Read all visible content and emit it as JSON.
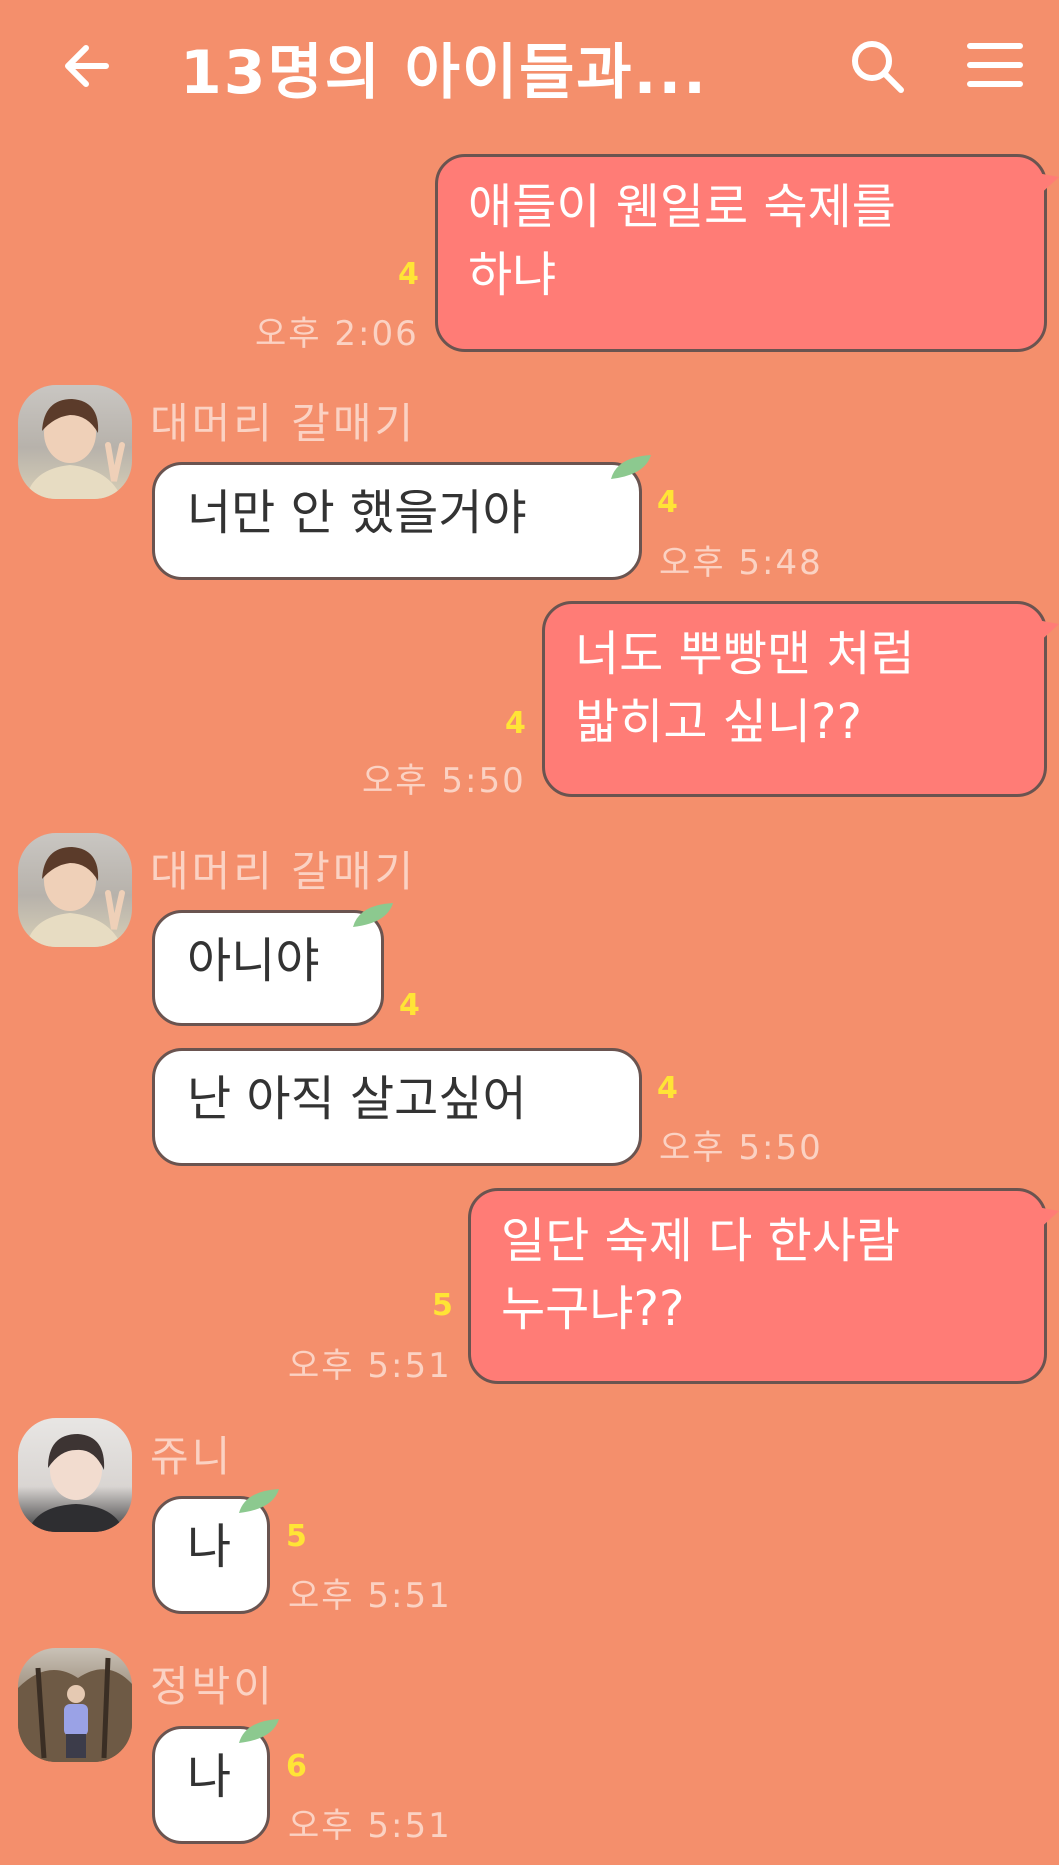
{
  "header": {
    "title": "13명의 아이들과...",
    "back_icon": "back-arrow-icon",
    "search_icon": "search-icon",
    "menu_icon": "menu-icon",
    "text_color": "#ffffff"
  },
  "theme": {
    "background": "#F48F6C",
    "my_bubble": "#FF7C76",
    "their_bubble": "#FFFFFF",
    "unread_color": "#FFE436",
    "meta_color": "#FBD2C3"
  },
  "messages": [
    {
      "sender": "me",
      "lines": [
        "애들이 웬일로 숙제를",
        "하냐"
      ],
      "unread": "4",
      "time": "오후 2:06"
    },
    {
      "sender_name": "대머리 갈매기",
      "text": "너만 안 했을거야",
      "unread": "4",
      "time": "오후 5:48"
    },
    {
      "sender": "me",
      "lines": [
        "너도 뿌빵맨 처럼",
        "밟히고 싶니??"
      ],
      "unread": "4",
      "time": "오후 5:50"
    },
    {
      "sender_name": "대머리 갈매기",
      "text": "아니야",
      "unread": "4"
    },
    {
      "text": "난 아직 살고싶어",
      "unread": "4",
      "time": "오후 5:50"
    },
    {
      "sender": "me",
      "lines": [
        "일단 숙제 다 한사람",
        "누구냐??"
      ],
      "unread": "5",
      "time": "오후 5:51"
    },
    {
      "sender_name": "쥬니",
      "text": "나",
      "unread": "5",
      "time": "오후 5:51"
    },
    {
      "sender_name": "정박이",
      "text": "나",
      "unread": "6",
      "time": "오후 5:51"
    }
  ]
}
